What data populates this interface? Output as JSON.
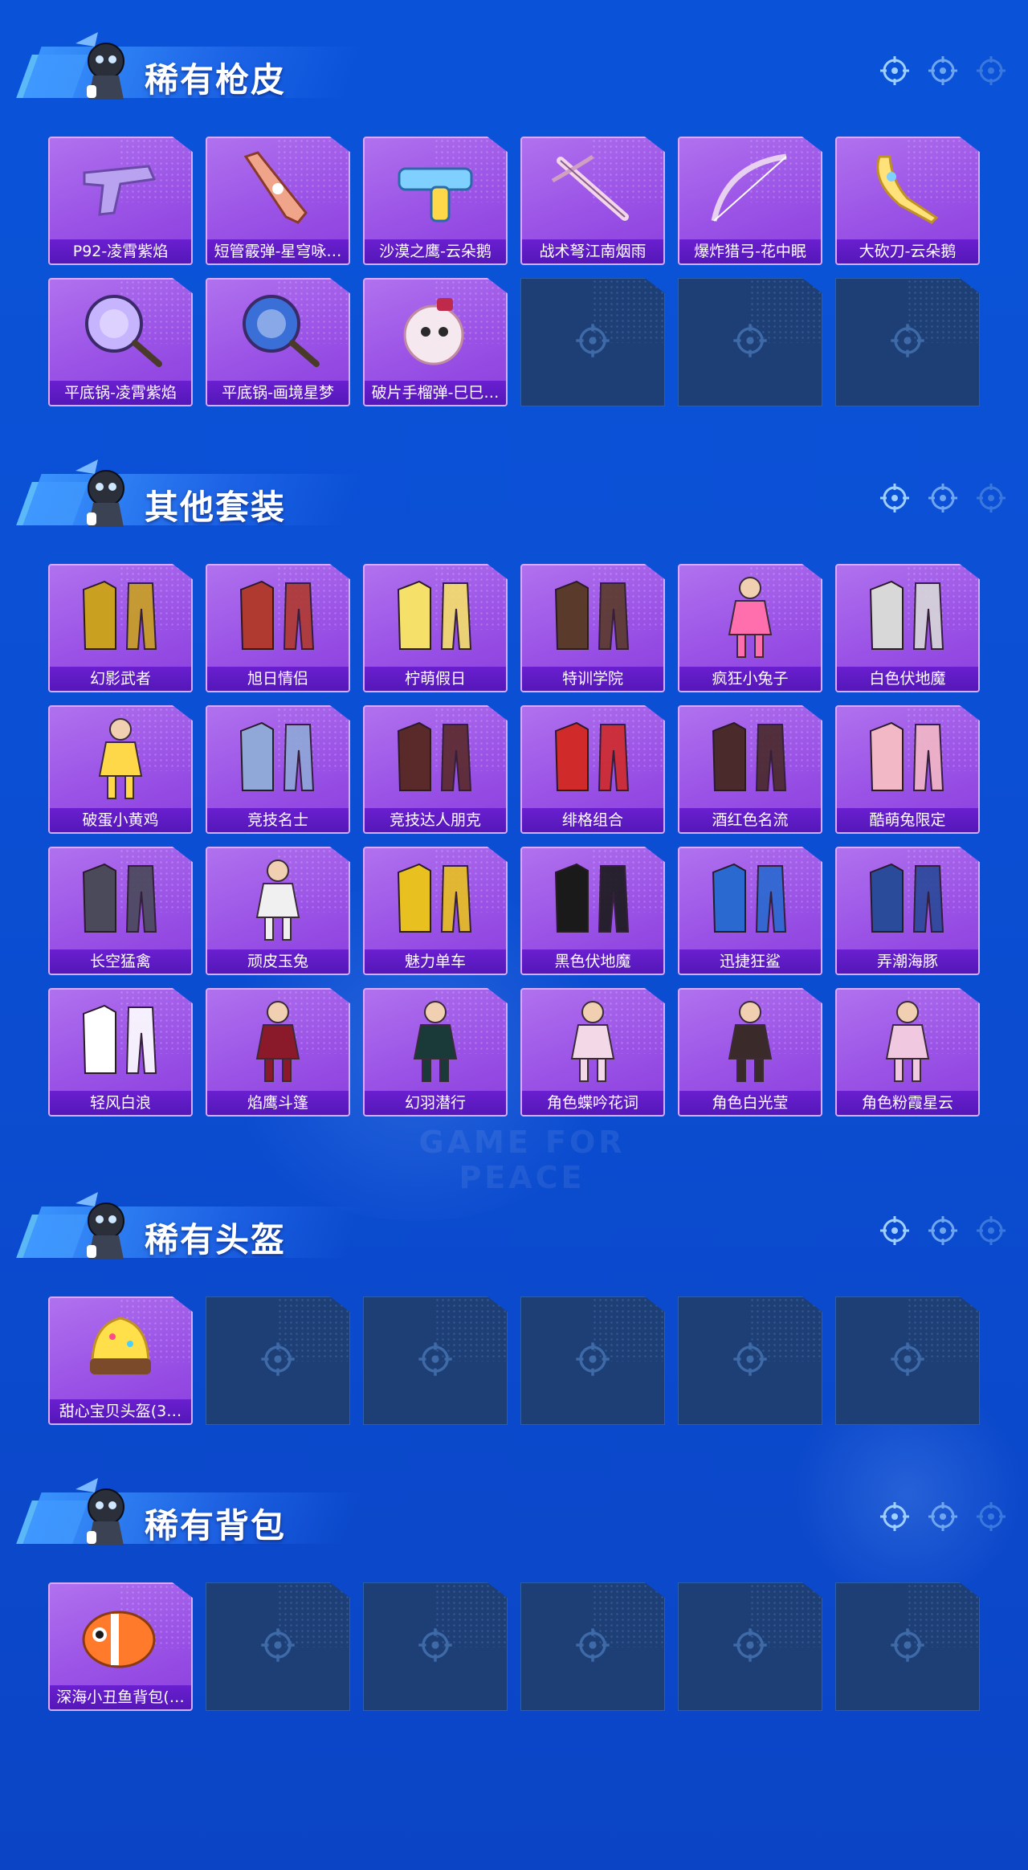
{
  "sections": [
    {
      "title": "稀有枪皮",
      "items": [
        {
          "label": "P92-凌霄紫焰",
          "icon": "pistol-icon",
          "color": "#b9a3f0"
        },
        {
          "label": "短管霰弹-星穹咏…",
          "icon": "shotgun-icon",
          "color": "#f0a48a"
        },
        {
          "label": "沙漠之鹰-云朵鹅",
          "icon": "water-pistol-icon",
          "color": "#7fd0ff"
        },
        {
          "label": "战术弩江南烟雨",
          "icon": "crossbow-icon",
          "color": "#f2d7e8"
        },
        {
          "label": "爆炸猎弓-花中眠",
          "icon": "bow-icon",
          "color": "#e8d0f0"
        },
        {
          "label": "大砍刀-云朵鹅",
          "icon": "machete-icon",
          "color": "#ffe27a"
        },
        {
          "label": "平底锅-凌霄紫焰",
          "icon": "pan-icon",
          "color": "#c6b4ff"
        },
        {
          "label": "平底锅-画境星梦",
          "icon": "pan-icon",
          "color": "#3b6fd8"
        },
        {
          "label": "破片手榴弹-巳巳…",
          "icon": "grenade-icon",
          "color": "#f5e8ef"
        }
      ],
      "empty_count": 3
    },
    {
      "title": "其他套装",
      "items": [
        {
          "label": "幻影武者",
          "icon": "outfit-icon",
          "color": "#c9a020"
        },
        {
          "label": "旭日情侣",
          "icon": "outfit-icon",
          "color": "#b03a30"
        },
        {
          "label": "柠萌假日",
          "icon": "outfit-icon",
          "color": "#f5e06a"
        },
        {
          "label": "特训学院",
          "icon": "outfit-icon",
          "color": "#5a3a2a"
        },
        {
          "label": "疯狂小兔子",
          "icon": "character-icon",
          "color": "#ff6fae"
        },
        {
          "label": "白色伏地魔",
          "icon": "outfit-icon",
          "color": "#d8d8d8"
        },
        {
          "label": "破蛋小黄鸡",
          "icon": "character-icon",
          "color": "#ffd84a"
        },
        {
          "label": "竞技名士",
          "icon": "outfit-icon",
          "color": "#8fa8d8"
        },
        {
          "label": "竞技达人朋克",
          "icon": "outfit-icon",
          "color": "#5a2a2a"
        },
        {
          "label": "绯格组合",
          "icon": "outfit-icon",
          "color": "#d02a2a"
        },
        {
          "label": "酒红色名流",
          "icon": "outfit-icon",
          "color": "#4a2a2a"
        },
        {
          "label": "酷萌兔限定",
          "icon": "outfit-icon",
          "color": "#f3b8c6"
        },
        {
          "label": "长空猛禽",
          "icon": "outfit-icon",
          "color": "#4a4a5a"
        },
        {
          "label": "顽皮玉兔",
          "icon": "character-icon",
          "color": "#f0f0f0"
        },
        {
          "label": "魅力单车",
          "icon": "outfit-icon",
          "color": "#e8c020"
        },
        {
          "label": "黑色伏地魔",
          "icon": "outfit-icon",
          "color": "#1a1a1a"
        },
        {
          "label": "迅捷狂鲨",
          "icon": "outfit-icon",
          "color": "#2a6ad0"
        },
        {
          "label": "弄潮海豚",
          "icon": "outfit-icon",
          "color": "#2a4a9a"
        },
        {
          "label": "轻风白浪",
          "icon": "outfit-icon",
          "color": "#ffffff"
        },
        {
          "label": "焰鹰斗篷",
          "icon": "character-icon",
          "color": "#8a1a2a"
        },
        {
          "label": "幻羽潜行",
          "icon": "character-icon",
          "color": "#1a3a3a"
        },
        {
          "label": "角色蝶吟花词",
          "icon": "character-icon",
          "color": "#f3d8e8"
        },
        {
          "label": "角色白光莹",
          "icon": "character-icon",
          "color": "#3a2a2a"
        },
        {
          "label": "角色粉霞星云",
          "icon": "character-icon",
          "color": "#f0c8e0"
        }
      ],
      "empty_count": 0
    },
    {
      "title": "稀有头盔",
      "items": [
        {
          "label": "甜心宝贝头盔(3…",
          "icon": "helmet-icon",
          "color": "#ffe04a"
        }
      ],
      "empty_count": 5
    },
    {
      "title": "稀有背包",
      "items": [
        {
          "label": "深海小丑鱼背包(…",
          "icon": "backpack-icon",
          "color": "#ff7a2a"
        }
      ],
      "empty_count": 5
    }
  ],
  "watermark": "GAME FOR PEACE",
  "colors": {
    "background": "#0b4fd4",
    "card": "#9a52e6",
    "card_label": "#5a18bd",
    "empty_slot": "#1d3f75"
  }
}
